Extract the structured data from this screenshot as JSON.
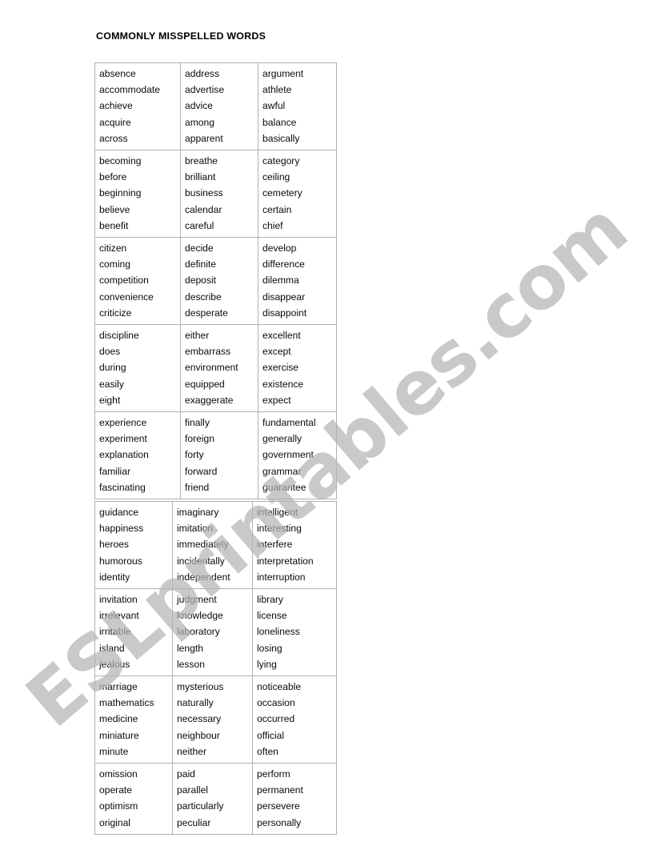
{
  "document": {
    "title": "COMMONLY MISSPELLED WORDS",
    "watermark": "ESLprintables.com",
    "border_color": "#b0b0b0",
    "watermark_color": "#b4b4b4",
    "text_color": "#0a0a0a"
  },
  "tables": [
    {
      "id": "table-one",
      "name": "misspelled-words-table-a-to-g",
      "rows": [
        {
          "columns": [
            [
              "absence",
              "accommodate",
              "achieve",
              "acquire",
              "across"
            ],
            [
              "address",
              "advertise",
              "advice",
              "among",
              "apparent"
            ],
            [
              "argument",
              "athlete",
              "awful",
              "balance",
              "basically"
            ]
          ]
        },
        {
          "columns": [
            [
              "becoming",
              "before",
              "beginning",
              "believe",
              "benefit"
            ],
            [
              "breathe",
              "brilliant",
              "business",
              "calendar",
              "careful"
            ],
            [
              "category",
              "ceiling",
              "cemetery",
              "certain",
              "chief"
            ]
          ]
        },
        {
          "columns": [
            [
              "citizen",
              "coming",
              "competition",
              "convenience",
              "criticize"
            ],
            [
              "decide",
              "definite",
              "deposit",
              "describe",
              "desperate"
            ],
            [
              "develop",
              "difference",
              "dilemma",
              "disappear",
              "disappoint"
            ]
          ]
        },
        {
          "columns": [
            [
              "discipline",
              "does",
              "during",
              "easily",
              "eight"
            ],
            [
              "either",
              "embarrass",
              "environment",
              "equipped",
              "exaggerate"
            ],
            [
              "excellent",
              "except",
              "exercise",
              "existence",
              "expect"
            ]
          ]
        },
        {
          "columns": [
            [
              "experience",
              "experiment",
              "explanation",
              "familiar",
              "fascinating"
            ],
            [
              "finally",
              "foreign",
              "forty",
              "forward",
              "friend"
            ],
            [
              "fundamental",
              "generally",
              "government",
              "grammar",
              "guarantee"
            ]
          ]
        }
      ]
    },
    {
      "id": "table-two",
      "name": "misspelled-words-table-g-to-p",
      "rows": [
        {
          "columns": [
            [
              "guidance",
              "happiness",
              "heroes",
              "humorous",
              "identity"
            ],
            [
              "imaginary",
              "imitation",
              "immediately",
              "incidentally",
              "independent"
            ],
            [
              "intelligent",
              "interesting",
              "interfere",
              "interpretation",
              "interruption"
            ]
          ]
        },
        {
          "columns": [
            [
              "invitation",
              "irrelevant",
              "irritable",
              "island",
              "jealous"
            ],
            [
              "judgment",
              "knowledge",
              "laboratory",
              "length",
              "lesson"
            ],
            [
              "library",
              "license",
              "loneliness",
              "losing",
              "lying"
            ]
          ]
        },
        {
          "columns": [
            [
              "marriage",
              "mathematics",
              "medicine",
              "miniature",
              "minute"
            ],
            [
              "mysterious",
              "naturally",
              "necessary",
              "neighbour",
              "neither"
            ],
            [
              "noticeable",
              "occasion",
              "occurred",
              "official",
              "often"
            ]
          ]
        },
        {
          "columns": [
            [
              "omission",
              "operate",
              "optimism",
              "original"
            ],
            [
              "paid",
              "parallel",
              "particularly",
              "peculiar"
            ],
            [
              "perform",
              "permanent",
              "persevere",
              "personally"
            ]
          ]
        }
      ]
    }
  ]
}
